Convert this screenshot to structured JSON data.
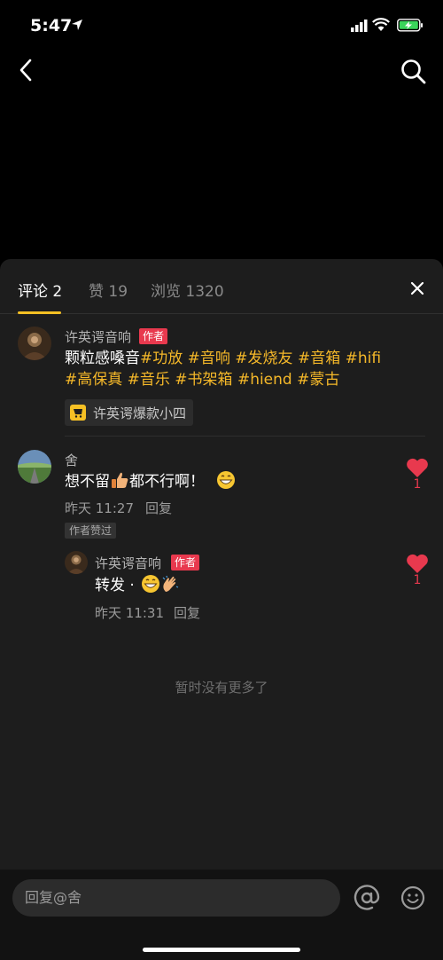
{
  "status": {
    "time": "5:47"
  },
  "tabs": [
    {
      "label": "评论 2"
    },
    {
      "label": "赞 19"
    },
    {
      "label": "浏览 1320"
    }
  ],
  "post": {
    "username": "许英谔音响",
    "author_tag": "作者",
    "line1_plain": "颗粒感嗓音",
    "line1_tags": "#功放 #音响 #发烧友 #音箱 #hifi",
    "line2_tags": "#高保真 #音乐 #书架箱 #hiend #蒙古",
    "product": "许英谔爆款小四"
  },
  "comment": {
    "username": "舍",
    "text_a": "想不留",
    "text_b": "都不行啊！",
    "time": "昨天 11:27",
    "reply_label": "回复",
    "liked_badge": "作者赞过",
    "likes": "1"
  },
  "reply": {
    "username": "许英谔音响",
    "author_tag": "作者",
    "text": "转发 ·",
    "time": "昨天 11:31",
    "reply_label": "回复",
    "likes": "1"
  },
  "no_more": "暂时没有更多了",
  "input": {
    "placeholder": "回复@舍"
  },
  "colors": {
    "accent": "#f5c024",
    "heart": "#e8394e",
    "tag": "#f5b829"
  }
}
